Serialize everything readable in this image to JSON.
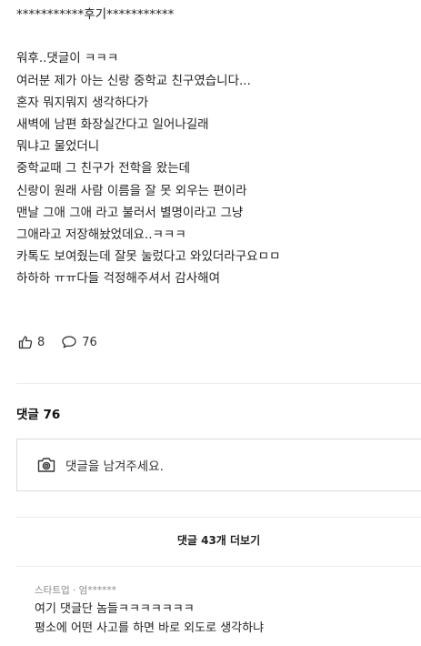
{
  "post": {
    "lines": [
      "***********후기***********",
      "",
      "워후..댓글이 ㅋㅋㅋ",
      "여러분 제가 아는 신랑 중학교 친구였습니다...",
      "혼자 뭐지뭐지 생각하다가",
      "새벽에 남편 화장실간다고 일어나길래",
      "뭐냐고 물었더니",
      "중학교때 그 친구가 전학을 왔는데",
      "신랑이 원래 사람 이름을 잘 못 외우는 편이라",
      "맨날 그애 그애 라고 불러서 별명이라고 그냥",
      "그애라고 저장해놨었데요..ㅋㅋㅋ",
      "카톡도 보여줬는데 잘못 눌렀다고 와있더라구요ㅁㅁ",
      "하하하 ㅠㅠ다들 걱정해주셔서 감사해여"
    ]
  },
  "reactions": {
    "likes": "8",
    "comments": "76",
    "like_icon": "thumbs-up-icon",
    "comment_icon": "speech-bubble-icon"
  },
  "comments_section": {
    "heading": "댓글 76",
    "input_placeholder": "댓글을 남겨주세요.",
    "camera_icon": "camera-icon",
    "more_button": "댓글 43개 더보기",
    "first_comment": {
      "meta": "스타트업 · 엄******",
      "lines": [
        "여기 댓글단 놈들ㅋㅋㅋㅋㅋㅋㅋ",
        "평소에 어떤 사고를 하면 바로 외도로 생각하냐"
      ]
    }
  },
  "colors": {
    "text": "#222222",
    "muted": "#8a8a8a",
    "border": "#dadada",
    "divider": "#ececec"
  }
}
